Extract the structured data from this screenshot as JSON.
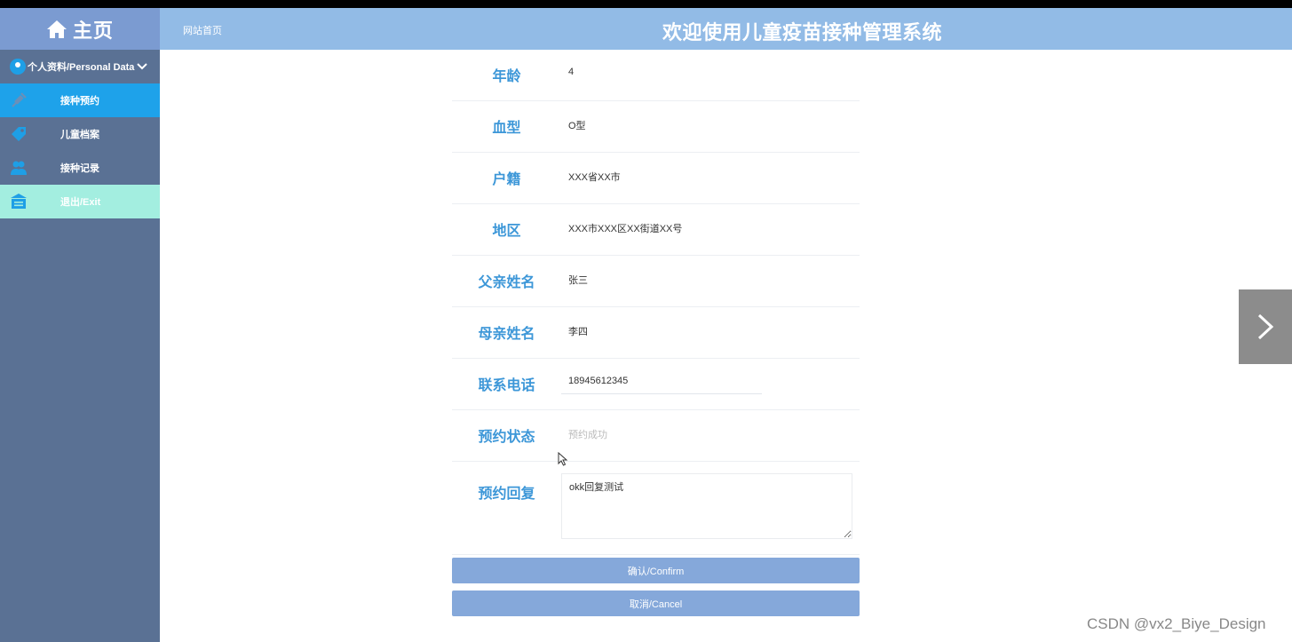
{
  "sidebar": {
    "brand": "主页",
    "profile_label": "个人资料/Personal Data",
    "items": [
      {
        "label": "接种预约",
        "icon": "syringe-icon",
        "active": true
      },
      {
        "label": "儿童档案",
        "icon": "tag-icon",
        "active": false
      },
      {
        "label": "接种记录",
        "icon": "users-icon",
        "active": false
      },
      {
        "label": "退出/Exit",
        "icon": "exit-icon",
        "active": false
      }
    ]
  },
  "header": {
    "breadcrumb": "网站首页",
    "title": "欢迎使用儿童疫苗接种管理系统"
  },
  "form": {
    "age": {
      "label": "年龄",
      "value": "4"
    },
    "blood_type": {
      "label": "血型",
      "value": "O型"
    },
    "household": {
      "label": "户籍",
      "value": "XXX省XX市"
    },
    "region": {
      "label": "地区",
      "value": "XXX市XXX区XX街道XX号"
    },
    "father_name": {
      "label": "父亲姓名",
      "value": "张三"
    },
    "mother_name": {
      "label": "母亲姓名",
      "value": "李四"
    },
    "phone": {
      "label": "联系电话",
      "value": "18945612345"
    },
    "status": {
      "label": "预约状态",
      "value": "预约成功"
    },
    "reply": {
      "label": "预约回复",
      "value": "okk回复测试"
    }
  },
  "buttons": {
    "confirm": "确认/Confirm",
    "cancel": "取消/Cancel"
  },
  "watermark": "CSDN @vx2_Biye_Design",
  "colors": {
    "sidebar_bg": "#5a7194",
    "brand_bg": "#7b9bd1",
    "header_bg": "#92bbe6",
    "active_item": "#1ea2ea",
    "exit_item": "#a3eee0",
    "label_blue": "#3d97d8",
    "button_bg": "#85a8da"
  }
}
